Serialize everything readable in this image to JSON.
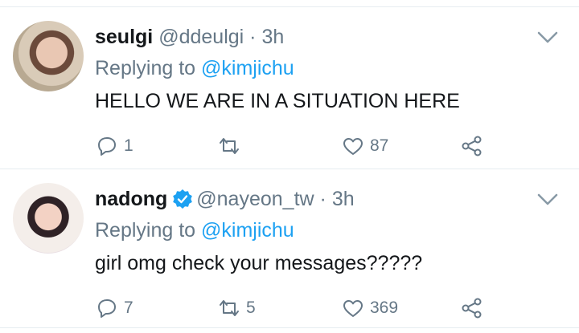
{
  "tweets": [
    {
      "name": "seulgi",
      "handle": "@ddeulgi",
      "separator": "·",
      "time": "3h",
      "replying_prefix": "Replying to",
      "replying_to": "@kimjichu",
      "text": "HELLO WE ARE IN A SITUATION HERE",
      "verified": false,
      "counts": {
        "replies": "1",
        "retweets": "",
        "likes": "87"
      }
    },
    {
      "name": "nadong",
      "handle": "@nayeon_tw",
      "separator": "·",
      "time": "3h",
      "replying_prefix": "Replying to",
      "replying_to": "@kimjichu",
      "text": "girl omg check your messages?????",
      "verified": true,
      "counts": {
        "replies": "7",
        "retweets": "5",
        "likes": "369"
      }
    }
  ],
  "colors": {
    "accent": "#1da1f2",
    "muted": "#657786",
    "text": "#14171a",
    "divider": "#e6ecf0"
  },
  "icons": [
    "chevron-down-icon",
    "reply-icon",
    "retweet-icon",
    "like-icon",
    "share-icon",
    "verified-badge-icon"
  ]
}
